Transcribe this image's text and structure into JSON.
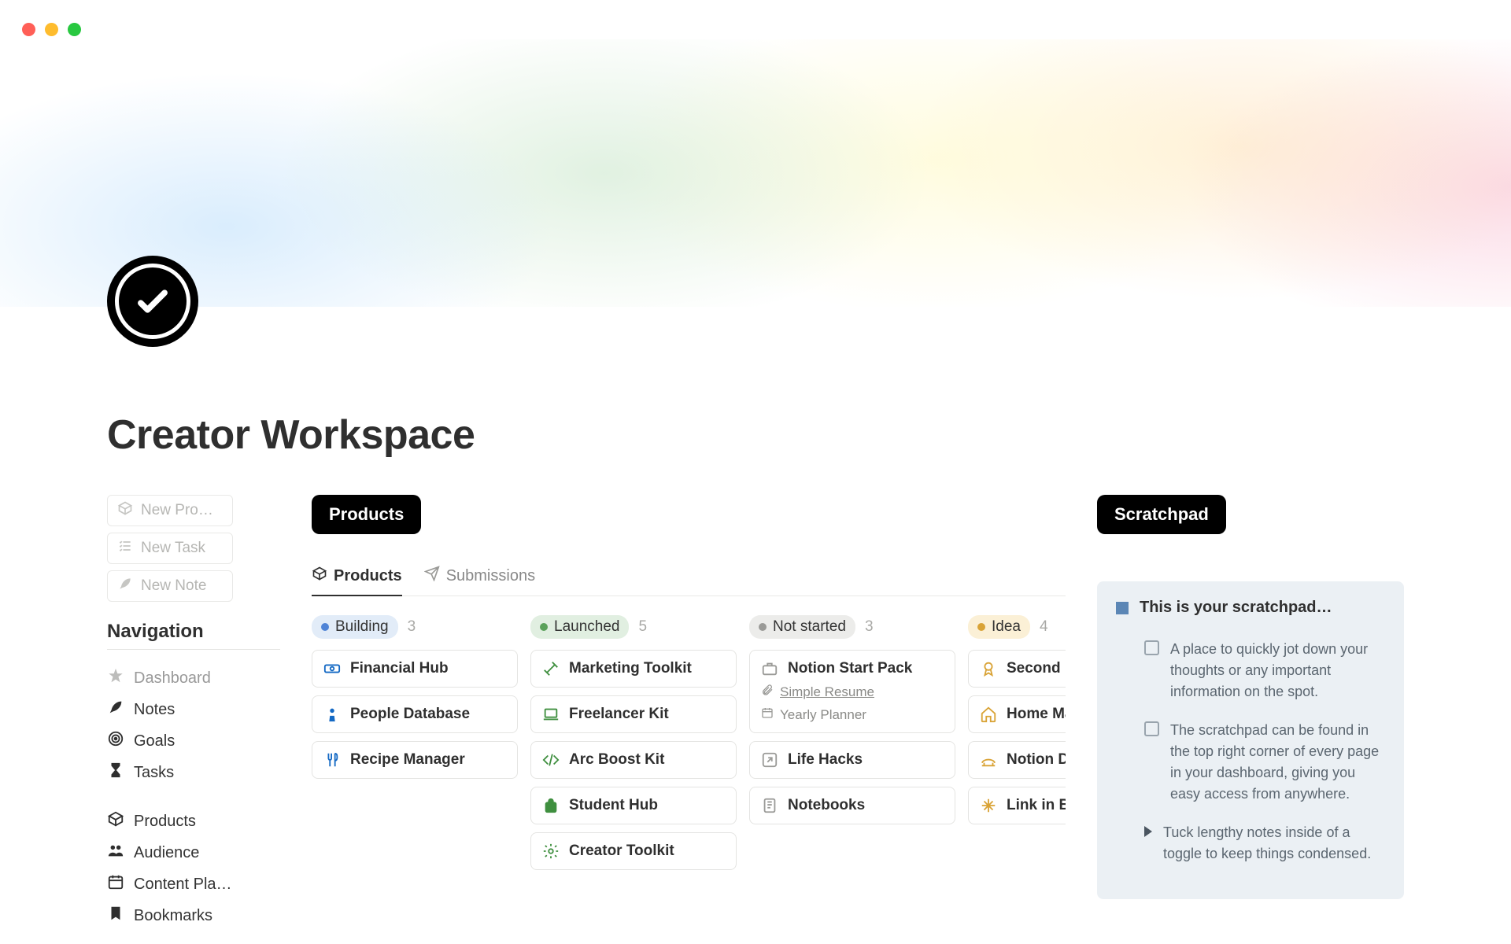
{
  "window": {
    "dots": [
      "#ff5f57",
      "#febc2e",
      "#28c840"
    ]
  },
  "page_title": "Creator Workspace",
  "new_buttons": [
    {
      "label": "New Pro…",
      "icon": "box"
    },
    {
      "label": "New Task",
      "icon": "checklist"
    },
    {
      "label": "New Note",
      "icon": "feather"
    }
  ],
  "nav_title": "Navigation",
  "nav_group1": [
    {
      "label": "Dashboard",
      "icon": "star",
      "muted": true
    },
    {
      "label": "Notes",
      "icon": "feather"
    },
    {
      "label": "Goals",
      "icon": "target"
    },
    {
      "label": "Tasks",
      "icon": "hourglass"
    }
  ],
  "nav_group2": [
    {
      "label": "Products",
      "icon": "box"
    },
    {
      "label": "Audience",
      "icon": "people"
    },
    {
      "label": "Content Pla…",
      "icon": "calendar"
    },
    {
      "label": "Bookmarks",
      "icon": "bookmark"
    }
  ],
  "products_pill": "Products",
  "tabs": [
    {
      "label": "Products",
      "icon": "box",
      "active": true
    },
    {
      "label": "Submissions",
      "icon": "send",
      "active": false
    }
  ],
  "columns": [
    {
      "name": "Building",
      "count": 3,
      "chip_bg": "#e2ecf8",
      "dot": "#5084d6",
      "cards": [
        {
          "label": "Financial Hub",
          "icon": "money",
          "color": "#1469c4"
        },
        {
          "label": "People Database",
          "icon": "pawn",
          "color": "#1469c4"
        },
        {
          "label": "Recipe Manager",
          "icon": "utensils",
          "color": "#1469c4"
        }
      ]
    },
    {
      "name": "Launched",
      "count": 5,
      "chip_bg": "#e1efe1",
      "dot": "#5aa15a",
      "cards": [
        {
          "label": "Marketing Toolkit",
          "icon": "tools",
          "color": "#3f8f3f"
        },
        {
          "label": "Freelancer Kit",
          "icon": "laptop",
          "color": "#3f8f3f"
        },
        {
          "label": "Arc Boost Kit",
          "icon": "code",
          "color": "#3f8f3f"
        },
        {
          "label": "Student Hub",
          "icon": "backpack",
          "color": "#3f8f3f"
        },
        {
          "label": "Creator Toolkit",
          "icon": "gear",
          "color": "#3f8f3f"
        }
      ]
    },
    {
      "name": "Not started",
      "count": 3,
      "chip_bg": "#ececea",
      "dot": "#9a9a97",
      "cards": [
        {
          "label": "Notion Start Pack",
          "icon": "briefcase",
          "color": "#9a9a97",
          "subs": [
            {
              "label": "Simple Resume",
              "icon": "clip",
              "underline": true
            },
            {
              "label": "Yearly Planner",
              "icon": "calendar",
              "underline": false
            }
          ]
        },
        {
          "label": "Life Hacks",
          "icon": "arrow-up-right",
          "color": "#9a9a97"
        },
        {
          "label": "Notebooks",
          "icon": "notebook",
          "color": "#9a9a97"
        }
      ]
    },
    {
      "name": "Idea",
      "count": 4,
      "chip_bg": "#fbf0d6",
      "dot": "#d9a336",
      "cards": [
        {
          "label": "Second Br",
          "icon": "medal",
          "color": "#d9a336"
        },
        {
          "label": "Home Mar",
          "icon": "house",
          "color": "#d9a336"
        },
        {
          "label": "Notion Div",
          "icon": "bridge",
          "color": "#d9a336"
        },
        {
          "label": "Link in Bio",
          "icon": "sparkle",
          "color": "#d9a336"
        }
      ]
    }
  ],
  "scratch_pill": "Scratchpad",
  "scratch_title": "This is your scratchpad…",
  "scratch_items": [
    {
      "type": "check",
      "text": "A place to quickly jot down your thoughts or any important information on the spot."
    },
    {
      "type": "check",
      "text": "The scratchpad can be found in the top right corner of every page in your dashboard, giving you easy access from anywhere."
    },
    {
      "type": "toggle",
      "text": "Tuck lengthy notes inside of a toggle to keep things condensed."
    }
  ]
}
